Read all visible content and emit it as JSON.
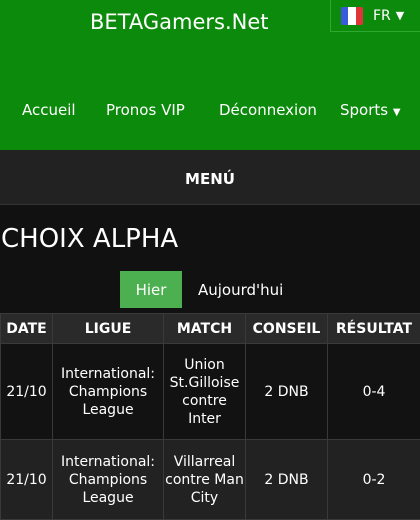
{
  "header": {
    "site_title": "BETAGamers.Net",
    "language": {
      "label": "FR",
      "flag_colors": [
        "#3a5bd9",
        "#ffffff",
        "#e0343b"
      ]
    },
    "nav": [
      "Accueil",
      "Pronos VIP",
      "Déconnexion",
      "Sports"
    ]
  },
  "menu_label": "MENÚ",
  "page_title": "CHOIX ALPHA",
  "tabs": {
    "active": "Hier",
    "other": "Aujourd'hui"
  },
  "table": {
    "headers": [
      "DATE",
      "LIGUE",
      "MATCH",
      "CONSEIL",
      "RÉSULTAT"
    ],
    "rows": [
      {
        "date": "21/10",
        "league": "International: Champions League",
        "match": "Union St.Gilloise contre Inter",
        "tip": "2 DNB",
        "result": "0-4"
      },
      {
        "date": "21/10",
        "league": "International: Champions League",
        "match": "Villarreal contre Man City",
        "tip": "2 DNB",
        "result": "0-2"
      }
    ]
  },
  "colors": {
    "header_green": "#0c8a0c",
    "tab_active": "#4caf50",
    "background": "#111111"
  }
}
